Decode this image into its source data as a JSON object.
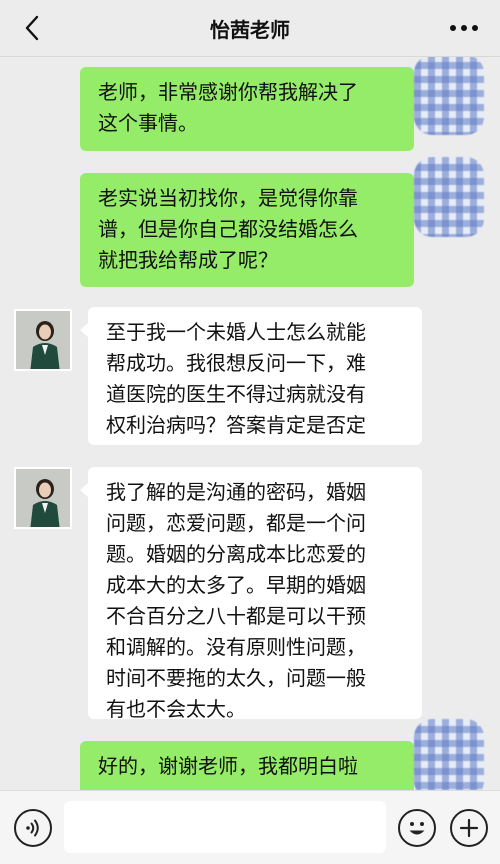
{
  "header": {
    "title": "怡茜老师",
    "back_icon": "chevron-left-icon",
    "more_icon": "more-dots-icon"
  },
  "messages": [
    {
      "sender": "me",
      "text": "老师，非常感谢你帮我解决了\n这个事情。"
    },
    {
      "sender": "me",
      "text": "老实说当初找你，是觉得你靠\n谱，但是你自己都没结婚怎么\n就把我给帮成了呢？"
    },
    {
      "sender": "teacher",
      "text": "至于我一个未婚人士怎么就能\n帮成功。我很想反问一下，难\n道医院的医生不得过病就没有\n权利治病吗？答案肯定是否定"
    },
    {
      "sender": "teacher",
      "text": "我了解的是沟通的密码，婚姻\n问题，恋爱问题，都是一个问\n题。婚姻的分离成本比恋爱的\n成本大的太多了。早期的婚姻\n不合百分之八十都是可以干预\n和调解的。没有原则性问题，\n时间不要拖的太久，问题一般\n有也不会太大。"
    },
    {
      "sender": "me",
      "text": "好的，谢谢老师，我都明白啦"
    }
  ],
  "input_bar": {
    "placeholder": "",
    "voice_icon": "voice-icon",
    "emoji_icon": "emoji-icon",
    "plus_icon": "plus-icon"
  },
  "colors": {
    "my_bubble": "#95ec69",
    "their_bubble": "#ffffff",
    "background": "#ececec"
  }
}
